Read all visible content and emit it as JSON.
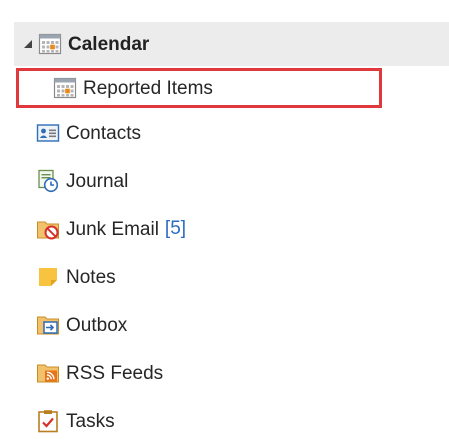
{
  "folders": {
    "calendar": {
      "label": "Calendar",
      "expanded": true
    },
    "reported_items": {
      "label": "Reported Items",
      "highlight_color": "#e0383d"
    },
    "contacts": {
      "label": "Contacts"
    },
    "journal": {
      "label": "Journal"
    },
    "junk_email": {
      "label": "Junk Email",
      "count": "[5]"
    },
    "notes": {
      "label": "Notes"
    },
    "outbox": {
      "label": "Outbox"
    },
    "rss_feeds": {
      "label": "RSS Feeds"
    },
    "tasks": {
      "label": "Tasks"
    }
  },
  "colors": {
    "header_bg": "#ececec",
    "count_text": "#2a6cc0",
    "highlight_border": "#e0383d"
  },
  "icons": {
    "calendar": "calendar-icon",
    "reported_items": "calendar-icon",
    "contacts": "contacts-card-icon",
    "journal": "journal-icon",
    "junk_email": "junk-folder-icon",
    "notes": "notes-icon",
    "outbox": "outbox-folder-icon",
    "rss_feeds": "rss-folder-icon",
    "tasks": "tasks-clipboard-icon"
  }
}
